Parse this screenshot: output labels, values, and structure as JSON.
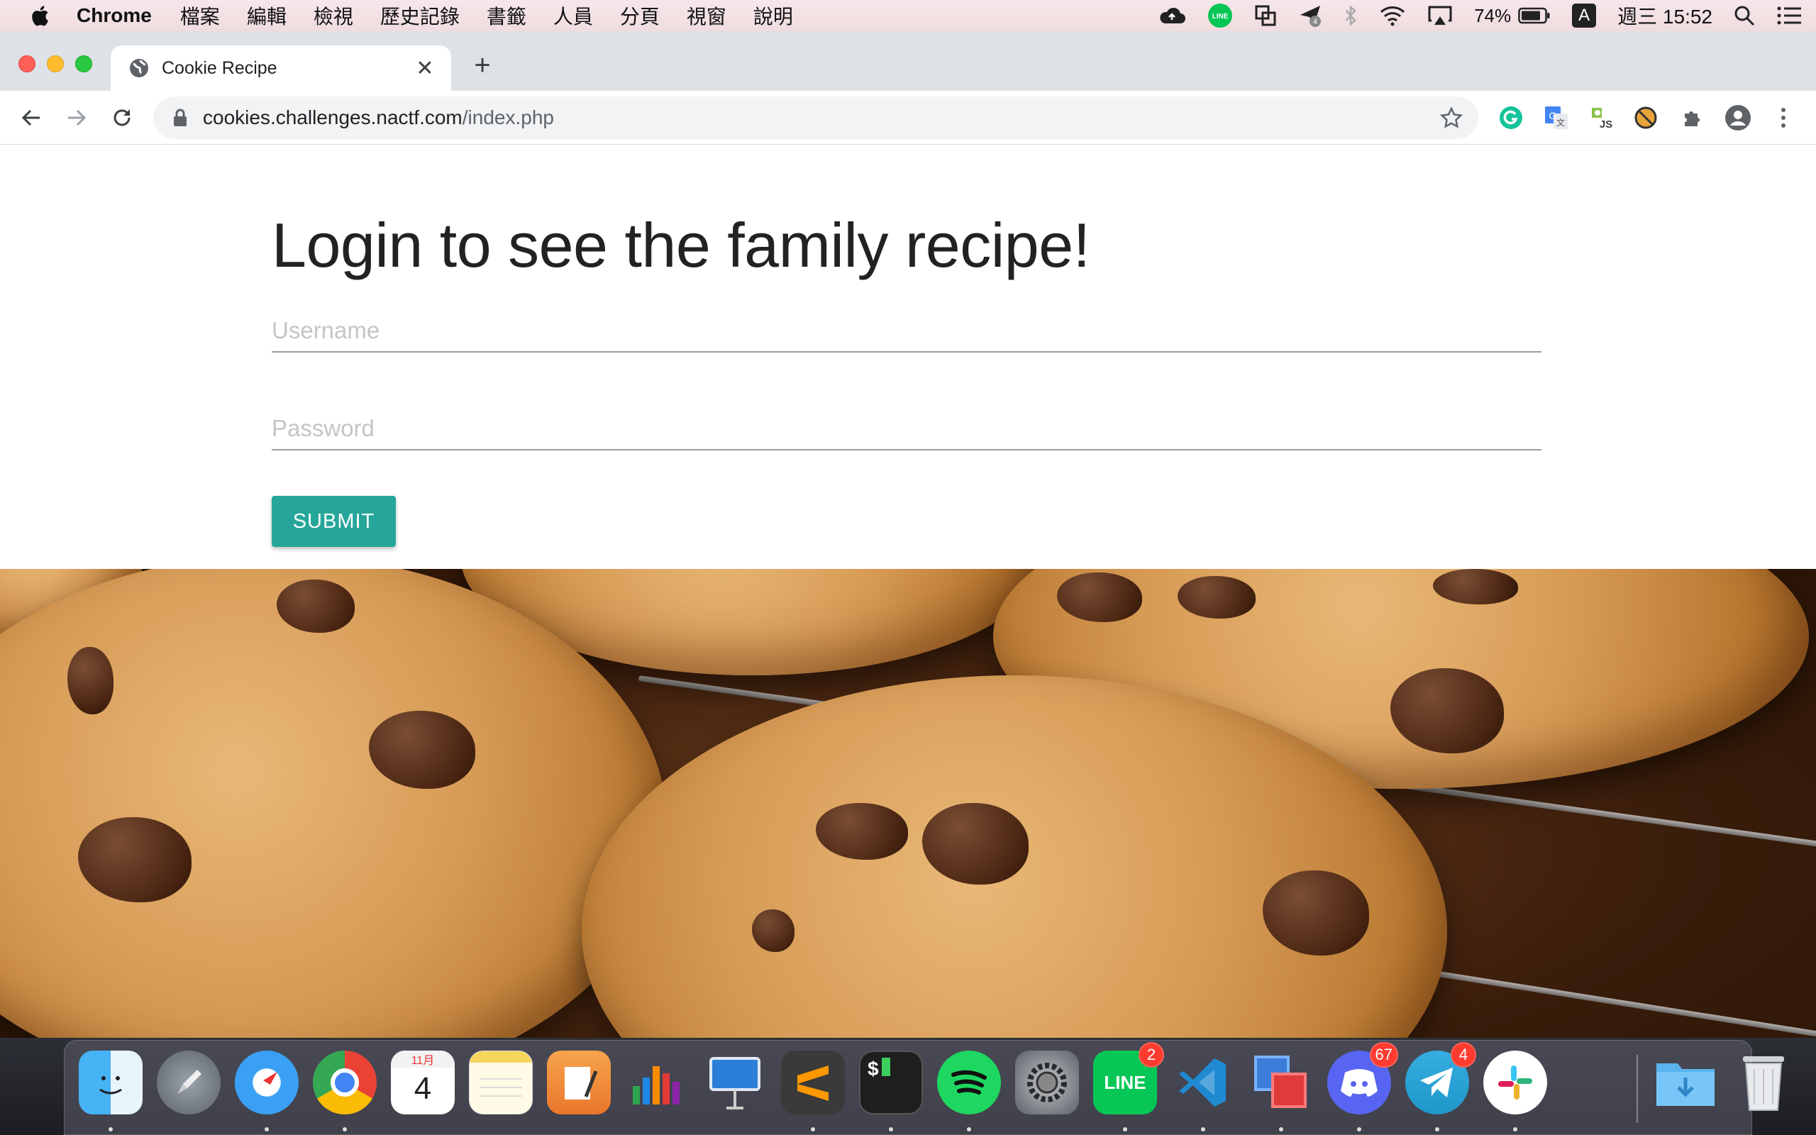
{
  "menubar": {
    "app_name": "Chrome",
    "items": [
      "檔案",
      "編輯",
      "檢視",
      "歷史記錄",
      "書籤",
      "人員",
      "分頁",
      "視窗",
      "說明"
    ],
    "battery": "74%",
    "input_method": "A",
    "clock": "週三 15:52"
  },
  "browser": {
    "tab_title": "Cookie Recipe",
    "url_host": "cookies.challenges.nactf.com",
    "url_path": "/index.php"
  },
  "page": {
    "heading": "Login to see the family recipe!",
    "username_placeholder": "Username",
    "password_placeholder": "Password",
    "submit_label": "SUBMIT",
    "accent_color": "#26a69a"
  },
  "dock": {
    "calendar_month": "11月",
    "calendar_day": "4",
    "line_label": "LINE",
    "line_badge": "2",
    "discord_badge": "67",
    "telegram_badge": "4",
    "terminal_prompt": "$"
  }
}
